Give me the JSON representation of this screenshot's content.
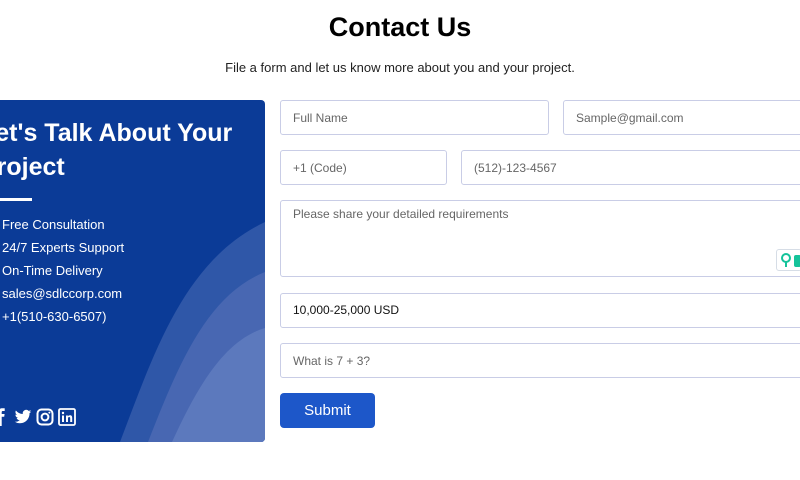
{
  "page": {
    "title": "Contact Us",
    "subtitle": "File a form and let us know more about you and your project."
  },
  "panel": {
    "heading_line1": "Let's Talk About Your",
    "heading_line2": "Project",
    "features": [
      "Free Consultation",
      "24/7 Experts Support",
      "On-Time Delivery",
      "sales@sdlccorp.com",
      "+1(510-630-6507)"
    ],
    "social_icons": [
      "facebook-icon",
      "twitter-icon",
      "instagram-icon",
      "linkedin-icon"
    ],
    "background_color": "#0b3b97"
  },
  "form": {
    "full_name_placeholder": "Full Name",
    "email_placeholder": "Sample@gmail.com",
    "country_code_placeholder": "+1 (Code)",
    "phone_placeholder": "(512)-123-4567",
    "requirements_placeholder": "Please share your detailed requirements",
    "budget_value": "10,000-25,000 USD",
    "captcha_placeholder": "What is 7 + 3?",
    "submit_label": "Submit"
  },
  "colors": {
    "submit_button": "#1d57c9",
    "field_border": "#c9cde6"
  }
}
